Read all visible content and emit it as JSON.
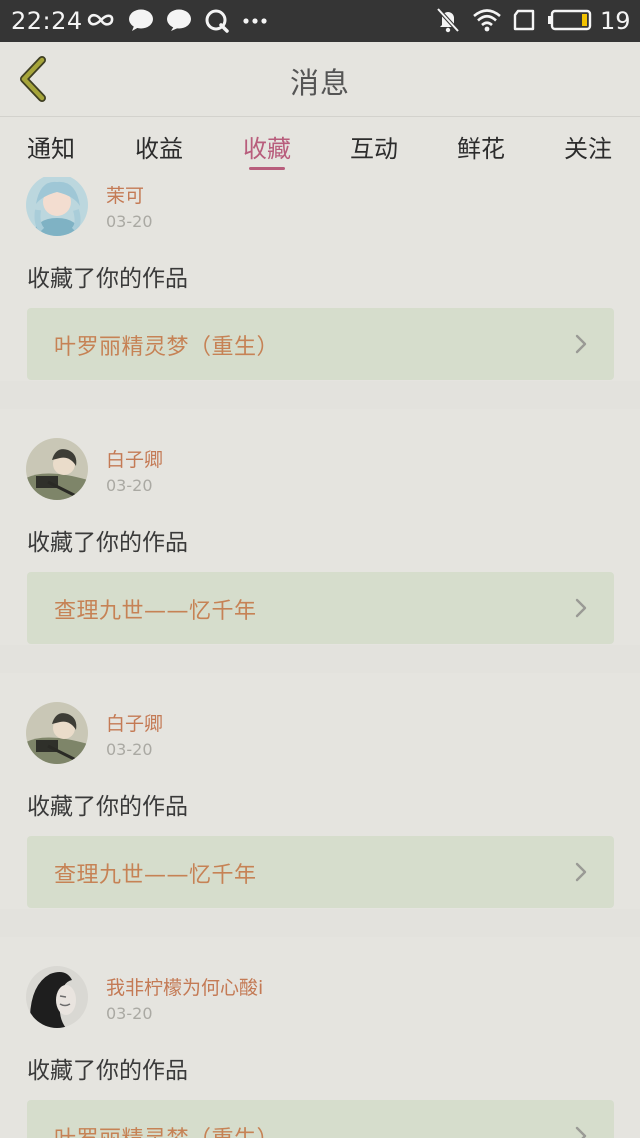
{
  "status_bar": {
    "time": "22:24",
    "battery_level": "19",
    "left_icons": [
      "infinity-icon",
      "message-bubble-icon",
      "chat-bubble-icon",
      "q-app-icon",
      "more-dots-icon"
    ],
    "right_icons": [
      "bell-muted-icon",
      "wifi-icon",
      "sim-card-icon",
      "battery-icon"
    ]
  },
  "header": {
    "title": "消息",
    "back_icon": "chevron-left-icon",
    "accent_color": "#8a8a2c"
  },
  "tabs": [
    {
      "label": "通知",
      "active": false
    },
    {
      "label": "收益",
      "active": false
    },
    {
      "label": "收藏",
      "active": true
    },
    {
      "label": "互动",
      "active": false
    },
    {
      "label": "鲜花",
      "active": false
    },
    {
      "label": "关注",
      "active": false
    }
  ],
  "active_color": "#b85d7c",
  "feed": [
    {
      "user": "茉可",
      "date": "03-20",
      "action": "收藏了你的作品",
      "work": "叶罗丽精灵梦（重生）",
      "avatar": "anime-girl-avatar"
    },
    {
      "user": "白子卿",
      "date": "03-20",
      "action": "收藏了你的作品",
      "work": "查理九世——忆千年",
      "avatar": "anime-character-avatar"
    },
    {
      "user": "白子卿",
      "date": "03-20",
      "action": "收藏了你的作品",
      "work": "查理九世——忆千年",
      "avatar": "anime-character-avatar"
    },
    {
      "user": "我非柠檬为何心酸i",
      "date": "03-20",
      "action": "收藏了你的作品",
      "work": "叶罗丽精灵梦（重生）",
      "avatar": "girl-portrait-avatar"
    }
  ]
}
